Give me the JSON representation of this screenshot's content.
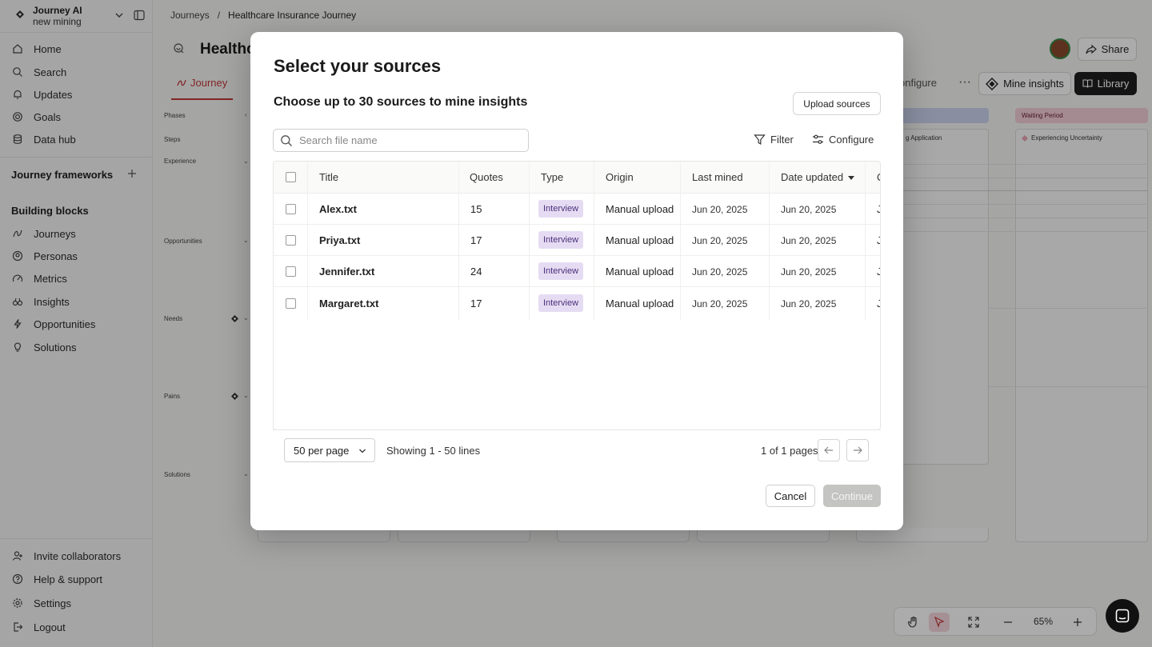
{
  "workspace": {
    "name": "Journey AI",
    "subtitle": "new mining"
  },
  "sidebar": {
    "nav": [
      {
        "label": "Home",
        "icon": "home-icon"
      },
      {
        "label": "Search",
        "icon": "search-icon"
      },
      {
        "label": "Updates",
        "icon": "bell-icon"
      },
      {
        "label": "Goals",
        "icon": "target-icon"
      },
      {
        "label": "Data hub",
        "icon": "database-icon"
      }
    ],
    "frameworks_title": "Journey frameworks",
    "blocks_title": "Building blocks",
    "blocks": [
      {
        "label": "Journeys",
        "icon": "journeys-icon"
      },
      {
        "label": "Personas",
        "icon": "personas-icon"
      },
      {
        "label": "Metrics",
        "icon": "metrics-icon"
      },
      {
        "label": "Insights",
        "icon": "insights-icon"
      },
      {
        "label": "Opportunities",
        "icon": "lightning-icon"
      },
      {
        "label": "Solutions",
        "icon": "lightbulb-icon"
      }
    ],
    "bottom": [
      {
        "label": "Invite collaborators",
        "icon": "invite-icon"
      },
      {
        "label": "Help & support",
        "icon": "help-icon"
      },
      {
        "label": "Settings",
        "icon": "gear-icon"
      },
      {
        "label": "Logout",
        "icon": "logout-icon"
      }
    ]
  },
  "header": {
    "breadcrumbs": [
      "Journeys",
      "/",
      "Healthcare Insurance Journey"
    ],
    "page_title_partial": "Healthc",
    "tab_journey": "Journey",
    "share_label": "Share",
    "configure_label": "onfigure",
    "more_label": "···",
    "mine_label": "Mine insights",
    "library_label": "Library"
  },
  "canvas": {
    "lanes": [
      "Phases",
      "Steps",
      "Experience",
      "Opportunities",
      "Needs",
      "Pains",
      "Solutions"
    ],
    "phase_left_partial": "",
    "phase_right": "Waiting Period",
    "step_left_partial": "g Application",
    "step_right": "Experiencing Uncertainty"
  },
  "toolbar": {
    "zoom": "65%"
  },
  "modal": {
    "title": "Select your sources",
    "subtitle": "Choose up to 30 sources to mine insights",
    "upload_label": "Upload sources",
    "search_placeholder": "Search file name",
    "filter_label": "Filter",
    "configure_label": "Configure",
    "columns": [
      "Title",
      "Quotes",
      "Type",
      "Origin",
      "Last mined",
      "Date updated",
      "C"
    ],
    "rows": [
      {
        "title": "Alex.txt",
        "quotes": "15",
        "type": "Interview",
        "origin": "Manual upload",
        "last_mined": "Jun 20, 2025",
        "date_updated": "Jun 20, 2025",
        "extra": "J"
      },
      {
        "title": "Priya.txt",
        "quotes": "17",
        "type": "Interview",
        "origin": "Manual upload",
        "last_mined": "Jun 20, 2025",
        "date_updated": "Jun 20, 2025",
        "extra": "J"
      },
      {
        "title": "Jennifer.txt",
        "quotes": "24",
        "type": "Interview",
        "origin": "Manual upload",
        "last_mined": "Jun 20, 2025",
        "date_updated": "Jun 20, 2025",
        "extra": "J"
      },
      {
        "title": "Margaret.txt",
        "quotes": "17",
        "type": "Interview",
        "origin": "Manual upload",
        "last_mined": "Jun 20, 2025",
        "date_updated": "Jun 20, 2025",
        "extra": "J"
      }
    ],
    "per_page": "50 per page",
    "showing": "Showing 1 - 50 lines",
    "pages": "1 of 1 pages",
    "cancel_label": "Cancel",
    "continue_label": "Continue"
  },
  "colors": {
    "accent": "#c23a3a",
    "badge_bg": "#e5dcf3",
    "badge_text": "#4a2f7a",
    "dark_button": "#1f1f1f",
    "disabled_button": "#c4c4c2"
  }
}
